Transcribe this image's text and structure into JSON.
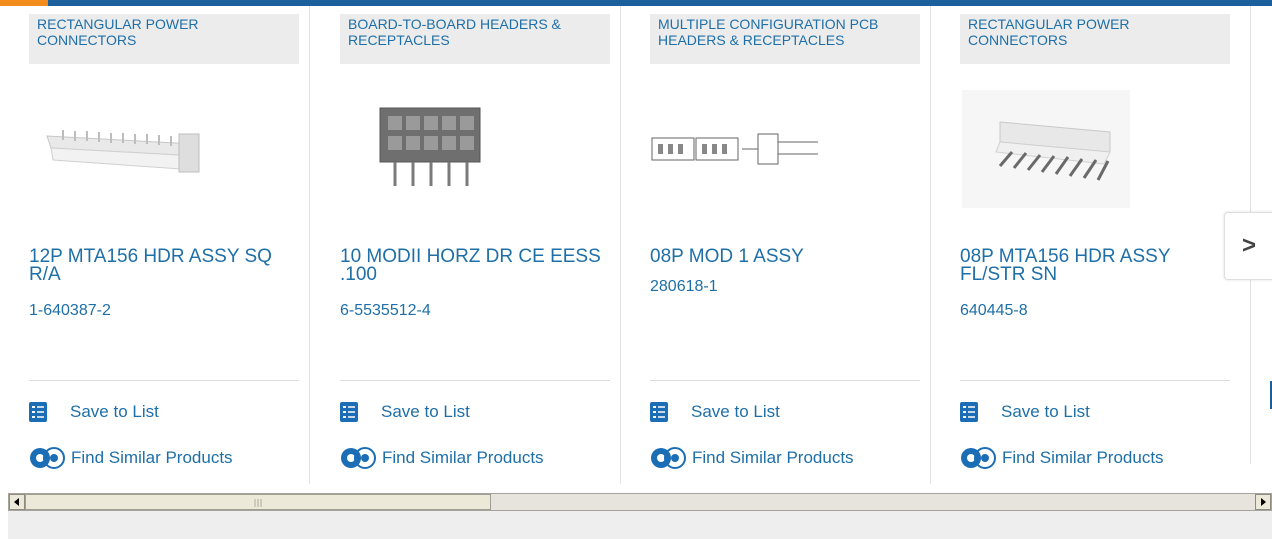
{
  "products": [
    {
      "category": "RECTANGULAR POWER CONNECTORS",
      "title": "12P MTA156 HDR ASSY SQ R/A",
      "part": "1-640387-2"
    },
    {
      "category": "BOARD-TO-BOARD HEADERS & RECEPTACLES",
      "title": "10 MODII HORZ DR CE EESS .100",
      "part": "6-5535512-4"
    },
    {
      "category": "MULTIPLE CONFIGURATION PCB HEADERS & RECEPTACLES",
      "title": "08P MOD 1 ASSY",
      "part": "280618-1"
    },
    {
      "category": "RECTANGULAR POWER CONNECTORS",
      "title": "08P MTA156 HDR ASSY FL/STR SN",
      "part": "640445-8"
    }
  ],
  "actions": {
    "save_label": "Save to List",
    "similar_label": "Find Similar Products"
  },
  "next_label": ">",
  "colors": {
    "link": "#1e6fa8",
    "brand": "#1b5f9c",
    "accent": "#f28c1c"
  }
}
